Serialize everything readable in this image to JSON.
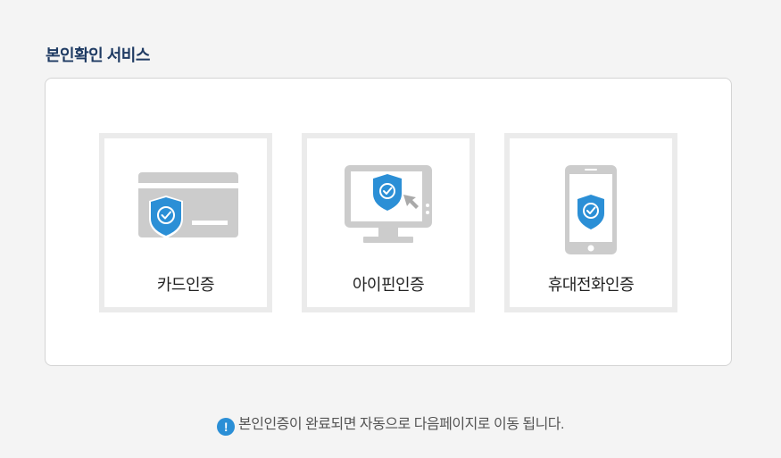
{
  "section": {
    "title": "본인확인 서비스"
  },
  "options": [
    {
      "label": "카드인증",
      "icon": "card-shield-icon"
    },
    {
      "label": "아이핀인증",
      "icon": "monitor-shield-icon"
    },
    {
      "label": "휴대전화인증",
      "icon": "phone-shield-icon"
    }
  ],
  "notice": {
    "icon": "exclamation-icon",
    "icon_glyph": "!",
    "text": "본인인증이 완료되면 자동으로 다음페이지로 이동 됩니다."
  },
  "colors": {
    "accent": "#2b8fd6",
    "title": "#1f3b63",
    "icon_gray": "#cccccc",
    "border": "#ebebeb"
  }
}
